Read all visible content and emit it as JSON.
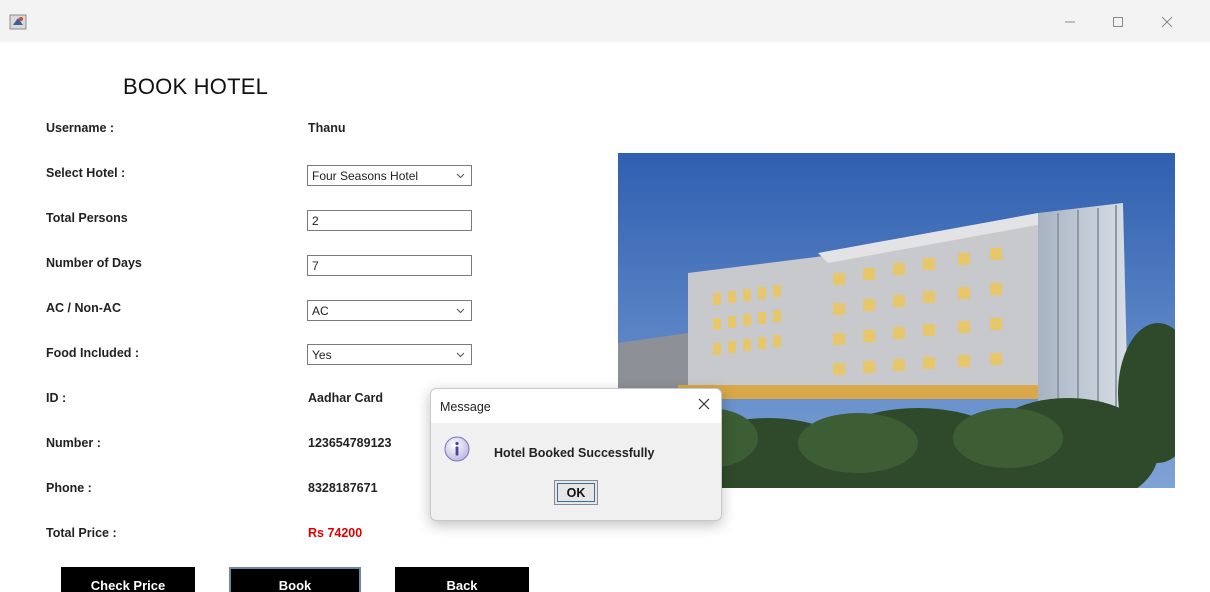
{
  "window": {
    "icons": {
      "app": "java-cup-icon",
      "minimize": "minimize-icon",
      "maximize": "maximize-icon",
      "close": "close-icon"
    }
  },
  "form": {
    "title": "BOOK HOTEL",
    "labels": {
      "username": "Username :",
      "select_hotel": "Select Hotel :",
      "total_persons": "Total Persons",
      "number_of_days": "Number of Days",
      "ac": "AC / Non-AC",
      "food": "Food Included :",
      "id": "ID :",
      "number": "Number :",
      "phone": "Phone :",
      "total_price": "Total Price :"
    },
    "values": {
      "username": "Thanu",
      "hotel": "Four Seasons Hotel",
      "total_persons": "2",
      "number_of_days": "7",
      "ac": "AC",
      "food": "Yes",
      "id": "Aadhar Card",
      "number": "123654789123",
      "phone": "8328187671",
      "total_price": "Rs 74200"
    },
    "price_color": "#e00000"
  },
  "buttons": {
    "check_price": "Check Price",
    "book": "Book",
    "back": "Back"
  },
  "dialog": {
    "title": "Message",
    "message": "Hotel Booked Successfully",
    "ok": "OK",
    "icon": "info-icon"
  },
  "photo": {
    "subject": "hotel-building-photo"
  }
}
